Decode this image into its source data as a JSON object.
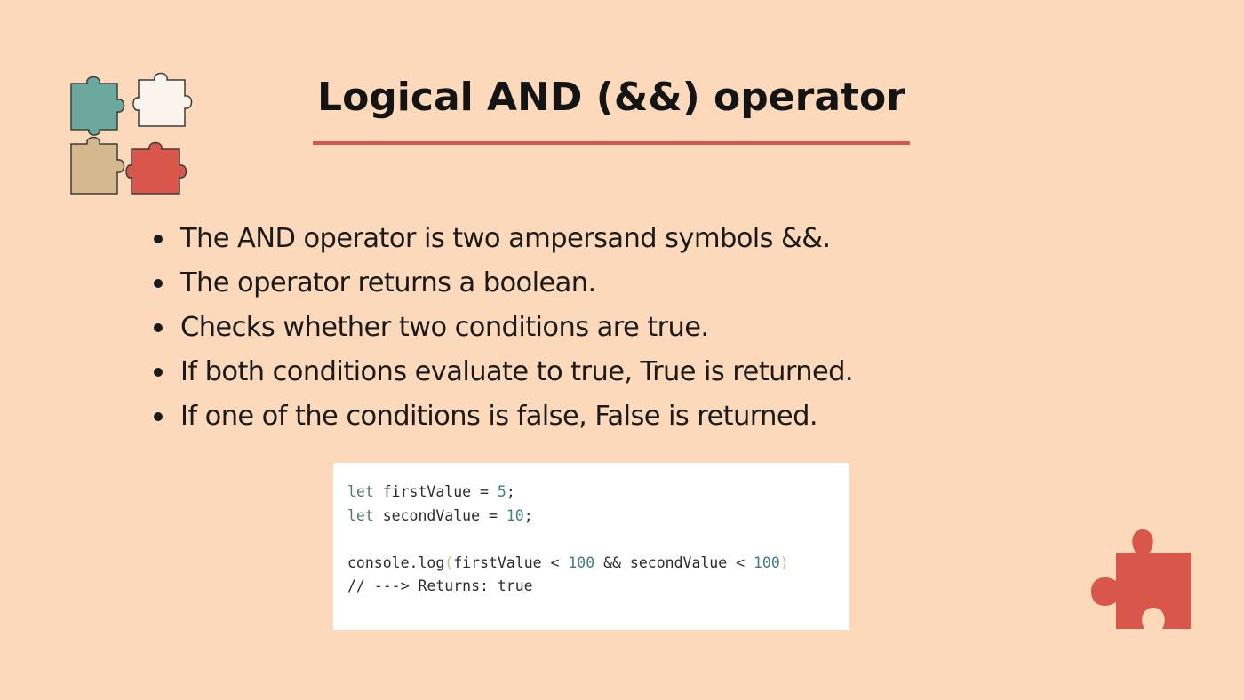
{
  "slide": {
    "title": "Logical AND (&&) operator",
    "bullets": [
      "The AND operator is two ampersand symbols &&.",
      "The operator returns a boolean.",
      "Checks whether two conditions are true.",
      "If both conditions evaluate to true, True is returned.",
      "If one of the conditions is false, False is returned."
    ],
    "code": {
      "line1": {
        "kw": "let",
        "rest": " firstValue = ",
        "num": "5",
        "end": ";"
      },
      "line2": {
        "kw": "let",
        "rest": " secondValue = ",
        "num": "10",
        "end": ";"
      },
      "line4": {
        "fn": "console.log",
        "open": "(",
        "a": "firstValue < ",
        "n1": "100",
        "b": " && secondValue < ",
        "n2": "100",
        "close": ")"
      },
      "line5": "// ---> Returns: true"
    }
  },
  "icons": {
    "cluster": "puzzle-pieces-icon",
    "solo": "puzzle-piece-icon"
  },
  "colors": {
    "background": "#fdd9bb",
    "accent": "#d9564a",
    "teal": "#6da89f",
    "cream": "#fbf4ec",
    "tan": "#d6b88f",
    "red": "#d9564a"
  }
}
